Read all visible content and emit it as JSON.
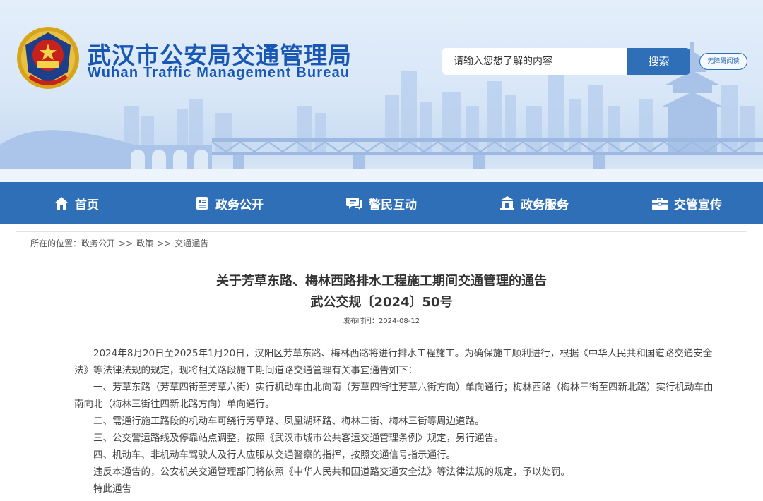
{
  "header": {
    "title": "武汉市公安局交通管理局",
    "subtitle": "Wuhan Traffic Management Bureau",
    "search_placeholder": "请输入您想了解的内容",
    "search_button": "搜索",
    "accessibility_button": "无障碍阅读",
    "colors": {
      "brand": "#1857b3",
      "nav": "#2f6fb8"
    }
  },
  "nav": {
    "items": [
      {
        "label": "首页",
        "icon": "home-icon"
      },
      {
        "label": "政务公开",
        "icon": "document-icon"
      },
      {
        "label": "警民互动",
        "icon": "chat-icon"
      },
      {
        "label": "政务服务",
        "icon": "building-icon"
      },
      {
        "label": "交管宣传",
        "icon": "briefcase-icon"
      }
    ]
  },
  "breadcrumb": {
    "prefix": "所在的位置：",
    "items": [
      "政务公开",
      "政策",
      "交通通告"
    ],
    "separator": ">>"
  },
  "article": {
    "title": "关于芳草东路、梅林西路排水工程施工期间交通管理的通告",
    "doc_number": "武公交规〔2024〕50号",
    "date_label": "发布时间：",
    "date": "2024-08-12",
    "paragraphs": [
      "2024年8月20日至2025年1月20日，汉阳区芳草东路、梅林西路将进行排水工程施工。为确保施工顺利进行，根据《中华人民共和国道路交通安全法》等法律法规的规定，现将相关路段施工期间道路交通管理有关事宜通告如下：",
      "一、芳草东路（芳草四街至芳草六街）实行机动车由北向南（芳草四街往芳草六街方向）单向通行；梅林西路（梅林三街至四新北路）实行机动车由南向北（梅林三街往四新北路方向）单向通行。",
      "二、需通行施工路段的机动车可绕行芳草路、凤凰湖环路、梅林二街、梅林三街等周边道路。",
      "三、公交营运路线及停靠站点调整，按照《武汉市城市公共客运交通管理条例》规定，另行通告。",
      "四、机动车、非机动车驾驶人及行人应服从交通警察的指挥，按照交通信号指示通行。",
      "违反本通告的，公安机关交通管理部门将依照《中华人民共和国道路交通安全法》等法律法规的规定，予以处罚。",
      "特此通告"
    ]
  }
}
